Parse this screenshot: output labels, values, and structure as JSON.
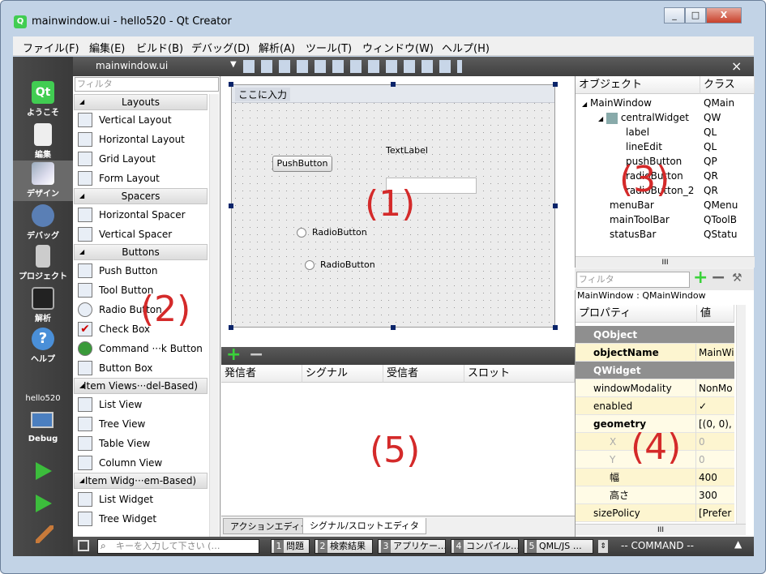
{
  "window": {
    "title": "mainwindow.ui - hello520 - Qt Creator",
    "min_label": "_",
    "max_label": "□",
    "close_label": "X"
  },
  "menu": [
    "ファイル(F)",
    "編集(E)",
    "ビルド(B)",
    "デバッグ(D)",
    "解析(A)",
    "ツール(T)",
    "ウィンドウ(W)",
    "ヘルプ(H)"
  ],
  "modes": [
    {
      "label": "ようこそ",
      "icon": "qt-logo-icon"
    },
    {
      "label": "編集",
      "icon": "edit-document-icon"
    },
    {
      "label": "デザイン",
      "icon": "design-pen-icon"
    },
    {
      "label": "デバッグ",
      "icon": "debug-bug-icon"
    },
    {
      "label": "プロジェクト",
      "icon": "project-wrench-icon"
    },
    {
      "label": "解析",
      "icon": "analyze-chart-icon"
    },
    {
      "label": "ヘルプ",
      "icon": "help-question-icon"
    }
  ],
  "kit": {
    "project": "hello520",
    "config": "Debug"
  },
  "topbar": {
    "file": "mainwindow.ui",
    "close": "×"
  },
  "widgetbox": {
    "filter_placeholder": "フィルタ",
    "categories": [
      "Layouts",
      "Spacers",
      "Buttons",
      "Item Views···del-Based)",
      "Item Widg···em-Based)"
    ],
    "items": [
      "Vertical Layout",
      "Horizontal Layout",
      "Grid Layout",
      "Form Layout",
      "Horizontal Spacer",
      "Vertical Spacer",
      "Push Button",
      "Tool Button",
      "Radio Button",
      "Check Box",
      "Command ···k Button",
      "Button Box",
      "List View",
      "Tree View",
      "Table View",
      "Column View",
      "List Widget",
      "Tree Widget"
    ]
  },
  "form": {
    "menu_placeholder": "ここに入力",
    "push_button": "PushButton",
    "text_label": "TextLabel",
    "radio1": "RadioButton",
    "radio2": "RadioButton"
  },
  "signal_editor": {
    "add": "+",
    "remove": "−",
    "columns": [
      "発信者",
      "シグナル",
      "受信者",
      "スロット"
    ],
    "tabs": [
      "アクションエディタ",
      "シグナル/スロットエディタ"
    ]
  },
  "object_inspector": {
    "columns": [
      "オブジェクト",
      "クラス"
    ],
    "rows": [
      {
        "name": "MainWindow",
        "cls": "QMain"
      },
      {
        "name": "centralWidget",
        "cls": "QW"
      },
      {
        "name": "label",
        "cls": "QL"
      },
      {
        "name": "lineEdit",
        "cls": "QL"
      },
      {
        "name": "pushButton",
        "cls": "QP"
      },
      {
        "name": "radioButton",
        "cls": "QR"
      },
      {
        "name": "radioButton_2",
        "cls": "QR"
      },
      {
        "name": "menuBar",
        "cls": "QMenu"
      },
      {
        "name": "mainToolBar",
        "cls": "QToolB"
      },
      {
        "name": "statusBar",
        "cls": "QStatu"
      }
    ],
    "scroll": "III"
  },
  "property_editor": {
    "filter_placeholder": "フィルタ",
    "context": "MainWindow : QMainWindow",
    "columns": [
      "プロパティ",
      "値"
    ],
    "groups": [
      "QObject",
      "QWidget"
    ],
    "rows": [
      {
        "name": "objectName",
        "value": "MainWi"
      },
      {
        "name": "windowModality",
        "value": "NonMo"
      },
      {
        "name": "enabled",
        "value": "✓"
      },
      {
        "name": "geometry",
        "value": "[(0, 0),"
      },
      {
        "name": "X",
        "value": "0"
      },
      {
        "name": "Y",
        "value": "0"
      },
      {
        "name": "幅",
        "value": "400"
      },
      {
        "name": "高さ",
        "value": "300"
      },
      {
        "name": "sizePolicy",
        "value": "[Prefer"
      }
    ],
    "scroll": "III"
  },
  "statusbar": {
    "search_placeholder": "キーを入力して下さい (…",
    "tabs": [
      {
        "num": "1",
        "label": "問題"
      },
      {
        "num": "2",
        "label": "検索結果"
      },
      {
        "num": "3",
        "label": "アプリケー…"
      },
      {
        "num": "4",
        "label": "コンパイル…"
      },
      {
        "num": "5",
        "label": "QML/JS …"
      }
    ],
    "command": "-- COMMAND --"
  },
  "annotations": [
    "(1)",
    "(2)",
    "(3)",
    "(4)",
    "(5)"
  ]
}
